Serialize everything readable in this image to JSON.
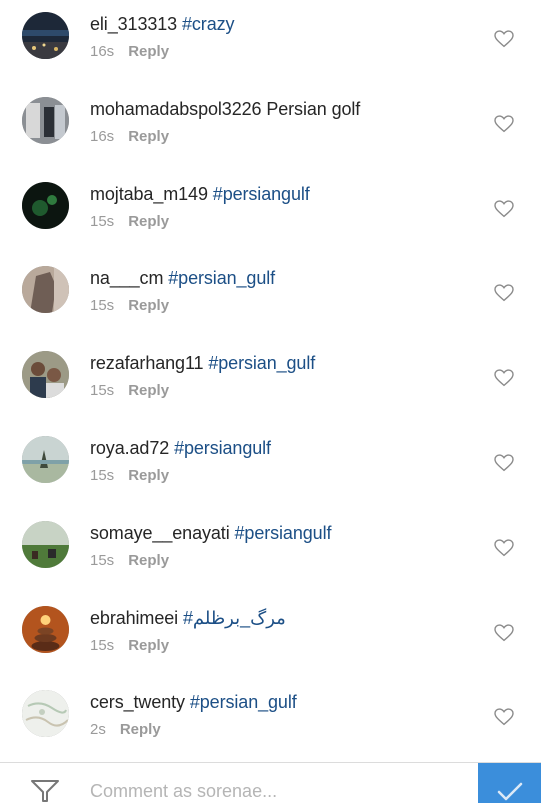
{
  "comments": [
    {
      "username": "eli_313313",
      "text": "#crazy",
      "time": "16s",
      "reply": "Reply",
      "avatar": "avatar-night-city"
    },
    {
      "username": "mohamadabspol3226",
      "text": "Persian golf",
      "time": "16s",
      "reply": "Reply",
      "avatar": "avatar-room"
    },
    {
      "username": "mojtaba_m149",
      "text": "#persiangulf",
      "time": "15s",
      "reply": "Reply",
      "avatar": "avatar-dark-green"
    },
    {
      "username": "na___cm",
      "text": "#persian_gulf",
      "time": "15s",
      "reply": "Reply",
      "avatar": "avatar-rock"
    },
    {
      "username": "rezafarhang11",
      "text": "#persian_gulf",
      "time": "15s",
      "reply": "Reply",
      "avatar": "avatar-people"
    },
    {
      "username": "roya.ad72",
      "text": "#persiangulf",
      "time": "15s",
      "reply": "Reply",
      "avatar": "avatar-beach"
    },
    {
      "username": "somaye__enayati",
      "text": "#persiangulf",
      "time": "15s",
      "reply": "Reply",
      "avatar": "avatar-field"
    },
    {
      "username": "ebrahimeei",
      "text": "#مرگ_برظلم",
      "time": "15s",
      "reply": "Reply",
      "avatar": "avatar-candle-stones"
    },
    {
      "username": "cers_twenty",
      "text": "#persian_gulf",
      "time": "2s",
      "reply": "Reply",
      "avatar": "avatar-map"
    }
  ],
  "composer": {
    "placeholder": "Comment as sorenae...",
    "filter_icon": "filter-icon",
    "send_icon": "checkmark-icon"
  },
  "colors": {
    "hashtag": "#1c4f86",
    "meta": "#9a9a9a",
    "send_button": "#3b8edb"
  }
}
